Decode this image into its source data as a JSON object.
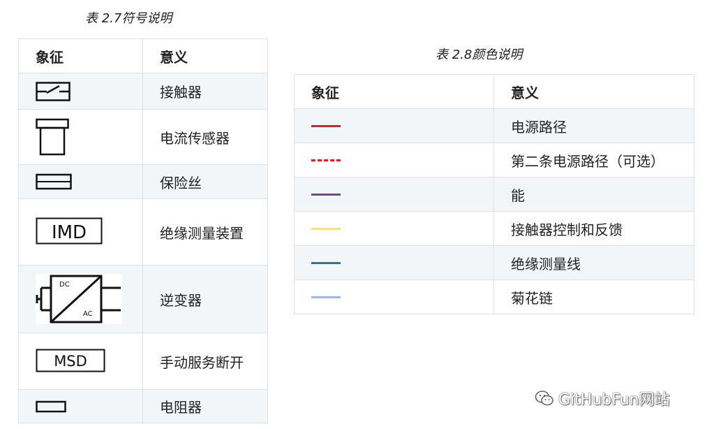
{
  "table1": {
    "caption": "表 2.7符号说明",
    "header": {
      "col1": "象征",
      "col2": "意义"
    },
    "rows": [
      {
        "symbol": "contactor-icon",
        "meaning": "接触器"
      },
      {
        "symbol": "current-sensor-icon",
        "meaning": "电流传感器"
      },
      {
        "symbol": "fuse-icon",
        "meaning": "保险丝"
      },
      {
        "symbol": "imd-icon",
        "symbol_text": "IMD",
        "meaning": "绝缘测量装置"
      },
      {
        "symbol": "inverter-icon",
        "symbol_text_top": "DC",
        "symbol_text_bottom": "AC",
        "meaning": "逆变器"
      },
      {
        "symbol": "msd-icon",
        "symbol_text": "MSD",
        "meaning": "手动服务断开"
      },
      {
        "symbol": "resistor-icon",
        "meaning": "电阻器"
      }
    ]
  },
  "table2": {
    "caption": "表 2.8颜色说明",
    "header": {
      "col1": "象征",
      "col2": "意义"
    },
    "rows": [
      {
        "color": "#e02020",
        "style": "solid",
        "meaning": "电源路径"
      },
      {
        "color": "#e02020",
        "style": "dashed",
        "meaning": "第二条电源路径（可选）"
      },
      {
        "color": "#7b3fa8",
        "style": "solid",
        "meaning": "能"
      },
      {
        "color": "#f7e08a",
        "style": "solid",
        "meaning": "接触器控制和反馈"
      },
      {
        "color": "#1f77b4",
        "style": "solid",
        "meaning": "绝缘测量线"
      },
      {
        "color": "#9db5e0",
        "style": "solid",
        "meaning": "菊花链"
      }
    ]
  },
  "watermark": {
    "text": "GitHubFun网站",
    "icon": "wechat-icon"
  }
}
